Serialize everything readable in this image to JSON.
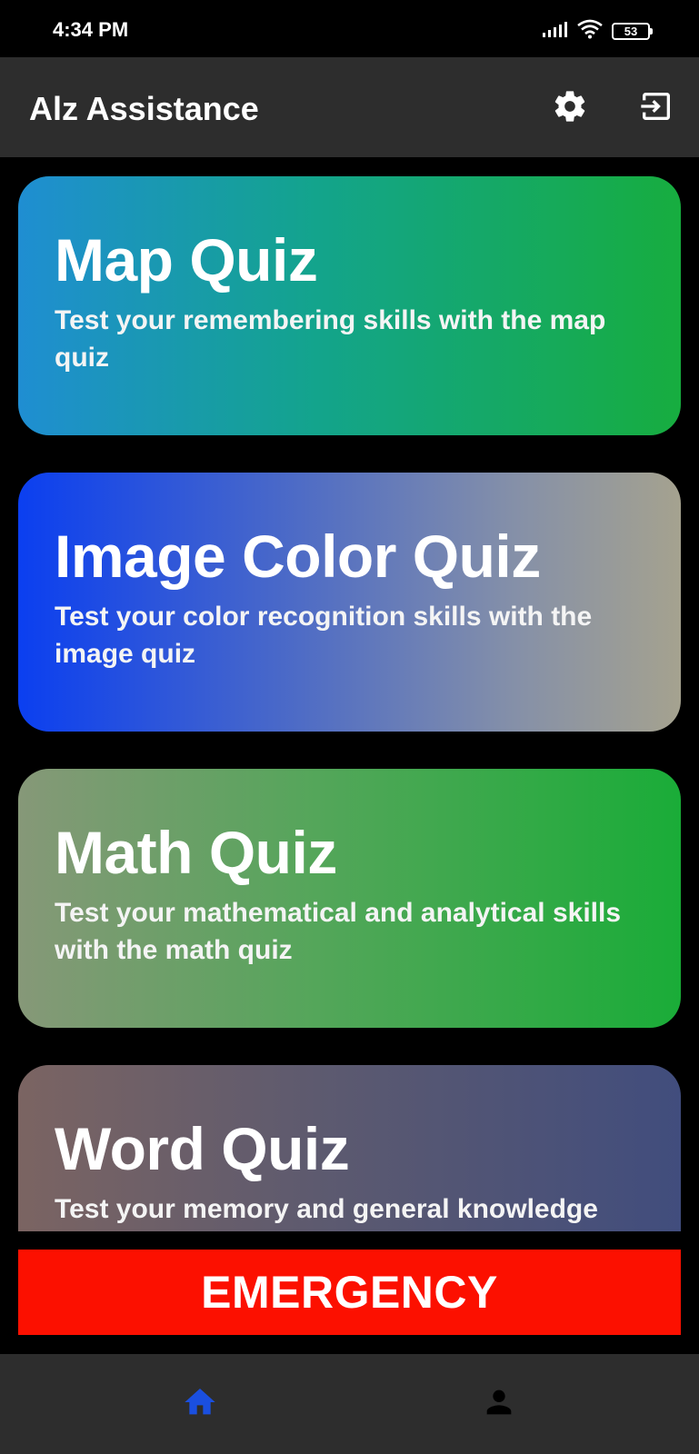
{
  "status_bar": {
    "time": "4:34 PM",
    "battery": "53",
    "icons": [
      "signal-icon",
      "wifi-icon",
      "battery-icon"
    ]
  },
  "app_bar": {
    "title": "Alz Assistance",
    "actions": [
      "gear-icon",
      "logout-icon"
    ]
  },
  "quizzes": [
    {
      "title": "Map Quiz",
      "description": "Test your remembering skills with the map quiz"
    },
    {
      "title": "Image Color Quiz",
      "description": "Test your color recognition skills with the image quiz"
    },
    {
      "title": "Math Quiz",
      "description": "Test your mathematical and analytical skills with the math quiz"
    },
    {
      "title": "Word Quiz",
      "description": "Test your memory and general knowledge"
    }
  ],
  "emergency_label": "EMERGENCY",
  "bottom_nav": {
    "items": [
      "home-icon",
      "profile-icon"
    ],
    "active_color": "#1a4fe0",
    "inactive_color": "#000000"
  },
  "colors": {
    "background": "#000000",
    "bar": "#2d2d2d",
    "emergency": "#fc1000"
  }
}
